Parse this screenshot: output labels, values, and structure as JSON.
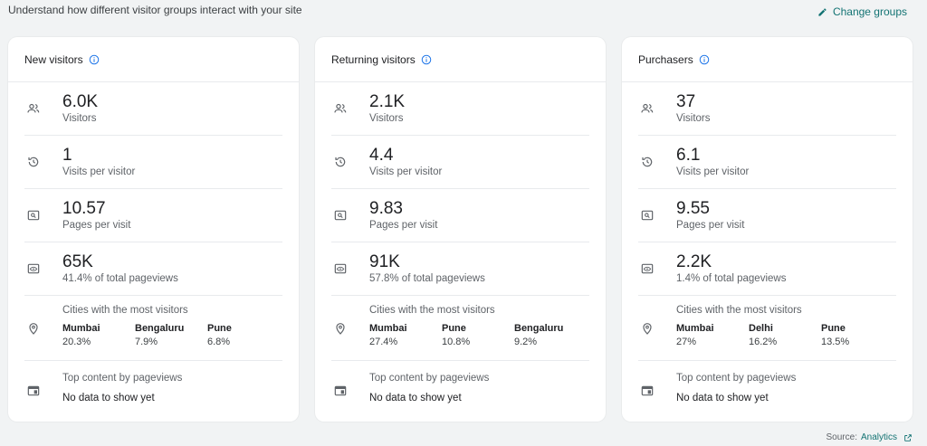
{
  "header": {
    "subtitle": "Understand how different visitor groups interact with your site",
    "change_groups_label": "Change groups"
  },
  "cards": [
    {
      "title": "New visitors",
      "visitors": {
        "value": "6.0K",
        "label": "Visitors"
      },
      "visits_per_visitor": {
        "value": "1",
        "label": "Visits per visitor"
      },
      "pages_per_visit": {
        "value": "10.57",
        "label": "Pages per visit"
      },
      "pageviews": {
        "value": "65K",
        "label": "41.4% of total pageviews"
      },
      "cities_label": "Cities with the most visitors",
      "cities": [
        {
          "name": "Mumbai",
          "pct": "20.3%"
        },
        {
          "name": "Bengaluru",
          "pct": "7.9%"
        },
        {
          "name": "Pune",
          "pct": "6.8%"
        }
      ],
      "top_content_label": "Top content by pageviews",
      "top_content_value": "No data to show yet"
    },
    {
      "title": "Returning visitors",
      "visitors": {
        "value": "2.1K",
        "label": "Visitors"
      },
      "visits_per_visitor": {
        "value": "4.4",
        "label": "Visits per visitor"
      },
      "pages_per_visit": {
        "value": "9.83",
        "label": "Pages per visit"
      },
      "pageviews": {
        "value": "91K",
        "label": "57.8% of total pageviews"
      },
      "cities_label": "Cities with the most visitors",
      "cities": [
        {
          "name": "Mumbai",
          "pct": "27.4%"
        },
        {
          "name": "Pune",
          "pct": "10.8%"
        },
        {
          "name": "Bengaluru",
          "pct": "9.2%"
        }
      ],
      "top_content_label": "Top content by pageviews",
      "top_content_value": "No data to show yet"
    },
    {
      "title": "Purchasers",
      "visitors": {
        "value": "37",
        "label": "Visitors"
      },
      "visits_per_visitor": {
        "value": "6.1",
        "label": "Visits per visitor"
      },
      "pages_per_visit": {
        "value": "9.55",
        "label": "Pages per visit"
      },
      "pageviews": {
        "value": "2.2K",
        "label": "1.4% of total pageviews"
      },
      "cities_label": "Cities with the most visitors",
      "cities": [
        {
          "name": "Mumbai",
          "pct": "27%"
        },
        {
          "name": "Delhi",
          "pct": "16.2%"
        },
        {
          "name": "Pune",
          "pct": "13.5%"
        }
      ],
      "top_content_label": "Top content by pageviews",
      "top_content_value": "No data to show yet"
    }
  ],
  "footer": {
    "source_prefix": "Source:",
    "source_link": "Analytics"
  },
  "colors": {
    "accent": "#137373",
    "info_icon": "#1a73e8",
    "icon_gray": "#5f6368"
  },
  "icons": {
    "visitors": "people-icon",
    "visits": "history-icon",
    "pages": "page-search-icon",
    "pageviews": "eye-icon",
    "cities": "location-pin-icon",
    "content": "web-content-icon"
  }
}
